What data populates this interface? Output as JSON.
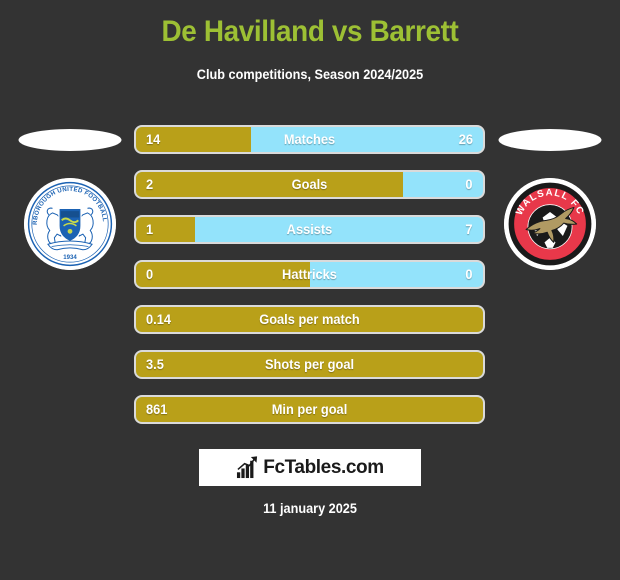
{
  "header": {
    "title": "De Havilland vs Barrett",
    "subtitle": "Club competitions, Season 2024/2025",
    "title_color": "#9dc034"
  },
  "crests": {
    "home": {
      "icon": "peterborough-united-fc-crest",
      "name": "Peterborough United Football Club",
      "arc_text": "PETERBOROUGH UNITED FOOTBALL CLUB",
      "year": "1934",
      "primary_color": "#1b62b3",
      "secondary_color": "#ffffff"
    },
    "away": {
      "icon": "walsall-fc-crest",
      "name": "Walsall FC",
      "arc_text": "WALSALL FC",
      "primary_color": "#e8384a",
      "secondary_color": "#b09a63",
      "ring_color": "#1a1a1a"
    }
  },
  "colors": {
    "background": "#333333",
    "home_bar": "#b9a019",
    "away_bar": "#93e3fb",
    "text": "#ffffff"
  },
  "chart_data": {
    "type": "bar",
    "title": "De Havilland vs Barrett",
    "subtitle": "Club competitions, Season 2024/2025",
    "orientation": "horizontal-paired",
    "series": [
      {
        "name": "De Havilland",
        "color": "#b9a019"
      },
      {
        "name": "Barrett",
        "color": "#93e3fb"
      }
    ],
    "categories": [
      "Matches",
      "Goals",
      "Assists",
      "Hattricks",
      "Goals per match",
      "Shots per goal",
      "Min per goal"
    ],
    "rows": [
      {
        "label": "Matches",
        "left": "14",
        "right": "26",
        "fill_percent": 33,
        "paired": true
      },
      {
        "label": "Goals",
        "left": "2",
        "right": "0",
        "fill_percent": 77,
        "paired": true
      },
      {
        "label": "Assists",
        "left": "1",
        "right": "7",
        "fill_percent": 17,
        "paired": true
      },
      {
        "label": "Hattricks",
        "left": "0",
        "right": "0",
        "fill_percent": 50,
        "paired": true
      },
      {
        "label": "Goals per match",
        "left": "0.14",
        "right": "",
        "fill_percent": 100,
        "paired": false
      },
      {
        "label": "Shots per goal",
        "left": "3.5",
        "right": "",
        "fill_percent": 100,
        "paired": false
      },
      {
        "label": "Min per goal",
        "left": "861",
        "right": "",
        "fill_percent": 100,
        "paired": false
      }
    ]
  },
  "footer": {
    "brand": "FcTables.com",
    "brand_icon": "bar-chart-arrow-icon",
    "date": "11 january 2025"
  }
}
